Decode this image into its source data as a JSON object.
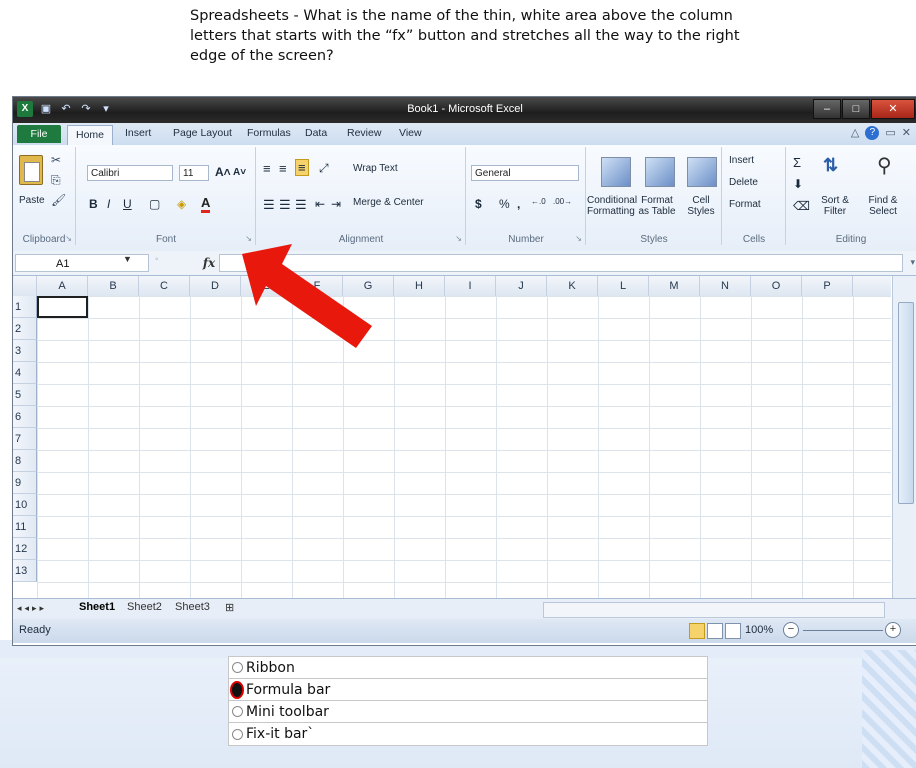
{
  "question": "Spreadsheets - What is the name of the thin, white area above the column letters that starts with the “fx” button and stretches all the way to the right edge of the screen?",
  "excel": {
    "title": "Book1 - Microsoft Excel",
    "tabs": [
      "File",
      "Home",
      "Insert",
      "Page Layout",
      "Formulas",
      "Data",
      "Review",
      "View"
    ],
    "ribbon": {
      "clipboard": {
        "paste": "Paste",
        "label": "Clipboard"
      },
      "font": {
        "name": "Calibri",
        "size": "11",
        "label": "Font"
      },
      "alignment": {
        "wrap": "Wrap Text",
        "merge": "Merge & Center",
        "label": "Alignment"
      },
      "number": {
        "format": "General",
        "currency": "$",
        "percent": "%",
        "comma": ",",
        "label": "Number"
      },
      "styles": {
        "conditional": "Conditional Formatting",
        "format_table": "Format as Table",
        "cell_styles": "Cell Styles",
        "label": "Styles"
      },
      "cells": {
        "insert": "Insert",
        "delete": "Delete",
        "format": "Format",
        "label": "Cells"
      },
      "editing": {
        "sort": "Sort & Filter",
        "find": "Find & Select",
        "label": "Editing"
      }
    },
    "formula_bar": {
      "cell_ref": "A1",
      "fx": "fx",
      "value": ""
    },
    "columns": [
      "A",
      "B",
      "C",
      "D",
      "E",
      "F",
      "G",
      "H",
      "I",
      "J",
      "K",
      "L",
      "M",
      "N",
      "O",
      "P"
    ],
    "rows": [
      "1",
      "2",
      "3",
      "4",
      "5",
      "6",
      "7",
      "8",
      "9",
      "10",
      "11",
      "12",
      "13"
    ],
    "sheets": [
      "Sheet1",
      "Sheet2",
      "Sheet3"
    ],
    "status": {
      "ready": "Ready",
      "zoom": "100%"
    }
  },
  "answers": [
    {
      "label": "Ribbon",
      "selected": false
    },
    {
      "label": "Formula bar",
      "selected": true
    },
    {
      "label": "Mini toolbar",
      "selected": false
    },
    {
      "label": "Fix-it bar`",
      "selected": false
    }
  ],
  "colors": {
    "arrow": "#e8180c",
    "file_tab": "#1f7a3f",
    "selected_radio_ring": "#dd0000"
  }
}
